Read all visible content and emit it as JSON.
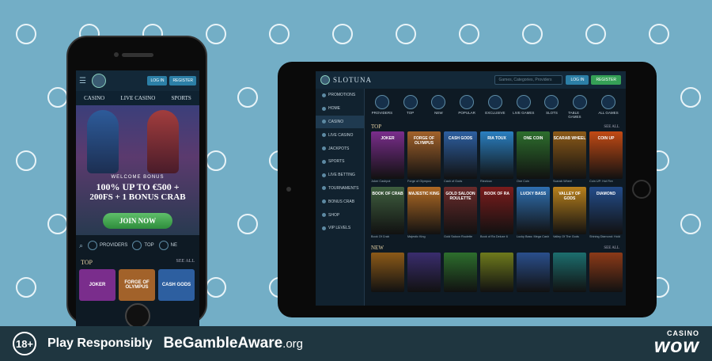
{
  "bottom_bar": {
    "age": "18+",
    "play_responsibly": "Play Responsibly",
    "begamble_main": "BeGambleAware",
    "begamble_org": ".org",
    "brand_small": "CASINO",
    "brand_big": "wow"
  },
  "colors": {
    "background": "#73aec6",
    "bar": "#1f3640",
    "accent_blue": "#2c7fa6",
    "accent_green": "#35a056",
    "gold": "#e7d3a5"
  },
  "phone": {
    "login": "LOG IN",
    "register": "REGISTER",
    "nav": [
      "CASINO",
      "LIVE CASINO",
      "SPORTS"
    ],
    "welcome": "WELCOME BONUS",
    "offer_line1": "100% UP TO €500 +",
    "offer_line2": "200FS + 1 BONUS CRAB",
    "join": "JOIN NOW",
    "cats": [
      {
        "label": "PROVIDERS",
        "icon": "providers-icon"
      },
      {
        "label": "TOP",
        "icon": "top-icon"
      },
      {
        "label": "NE",
        "icon": "new-icon"
      }
    ],
    "section_title": "TOP",
    "see_all": "SEE ALL",
    "games": [
      {
        "title": "JOKER",
        "color": "#7a2d8c"
      },
      {
        "title": "FORGE OF OLYMPUS",
        "color": "#a2622a"
      },
      {
        "title": "CASH GODS",
        "color": "#2d5fa0"
      }
    ]
  },
  "tablet": {
    "logo": "SLOTUNA",
    "search_placeholder": "Games, Categories, Providers",
    "login": "LOG IN",
    "register": "REGISTER",
    "sidebar": [
      {
        "label": "PROMOTIONS",
        "active": false
      },
      {
        "label": "HOME",
        "active": false
      },
      {
        "label": "CASINO",
        "active": true
      },
      {
        "label": "LIVE CASINO",
        "active": false
      },
      {
        "label": "JACKPOTS",
        "active": false
      },
      {
        "label": "SPORTS",
        "active": false
      },
      {
        "label": "LIVE BETTING",
        "active": false
      },
      {
        "label": "TOURNAMENTS",
        "active": false
      },
      {
        "label": "BONUS CRAB",
        "active": false
      },
      {
        "label": "SHOP",
        "active": false
      },
      {
        "label": "VIP LEVELS",
        "active": false
      }
    ],
    "categories": [
      {
        "label": "PROVIDERS",
        "icon": "providers-icon"
      },
      {
        "label": "TOP",
        "icon": "top-icon"
      },
      {
        "label": "NEW",
        "icon": "new-icon"
      },
      {
        "label": "POPULAR",
        "icon": "popular-icon"
      },
      {
        "label": "EXCLUSIVE",
        "icon": "exclusive-icon"
      },
      {
        "label": "LIVE GAMES",
        "icon": "live-games-icon"
      },
      {
        "label": "SLOTS",
        "icon": "slots-icon"
      },
      {
        "label": "TABLE GAMES",
        "icon": "table-games-icon"
      },
      {
        "label": "ALL GAMES",
        "icon": "all-games-icon"
      }
    ],
    "top_title": "TOP",
    "new_title": "NEW",
    "see_all": "SEE ALL",
    "top_games": [
      {
        "title": "JOKER",
        "name": "Joker Cashpot",
        "color": "#7a2d8c"
      },
      {
        "title": "FORGE OF OLYMPUS",
        "name": "Forge of Olympus",
        "color": "#a2622a"
      },
      {
        "title": "CASH GODS",
        "name": "Cash of Gods",
        "color": "#2d5fa0"
      },
      {
        "title": "RIA TOUX",
        "name": "Rieztoux",
        "color": "#2a7fc0"
      },
      {
        "title": "ONE COIN",
        "name": "One Coin",
        "color": "#2d6e2d"
      },
      {
        "title": "SCARAB WHEEL",
        "name": "Scarab Wheel",
        "color": "#8c5a18"
      },
      {
        "title": "COIN UP",
        "name": "Coin UP: Hot Fire",
        "color": "#c24a14"
      },
      {
        "title": "BOOK OF CRAB",
        "name": "Book Of Crab",
        "color": "#3f5f3f"
      },
      {
        "title": "MAJESTIC KING",
        "name": "Majestic King",
        "color": "#b06a24"
      },
      {
        "title": "GOLD SALOON ROULETTE",
        "name": "Gold Saloon Roulette",
        "color": "#6a2b2b"
      },
      {
        "title": "BOOK OF RA",
        "name": "Book of Ra Deluxe 6",
        "color": "#7a1c1c"
      },
      {
        "title": "LUCKY BASS",
        "name": "Lucky Bass: Mega Cash",
        "color": "#2f6fb0"
      },
      {
        "title": "VALLEY OF GODS",
        "name": "Valley Of The Gods",
        "color": "#b8801c"
      },
      {
        "title": "DIAMOND",
        "name": "Shining Diamond: Hold",
        "color": "#234c8a"
      }
    ],
    "new_games": [
      {
        "color": "#8c5a18"
      },
      {
        "color": "#3a2d6e"
      },
      {
        "color": "#2d6e2d"
      },
      {
        "color": "#6e7a1c"
      },
      {
        "color": "#2a4f8c"
      },
      {
        "color": "#1c6e6e"
      },
      {
        "color": "#8c3a18"
      }
    ]
  }
}
